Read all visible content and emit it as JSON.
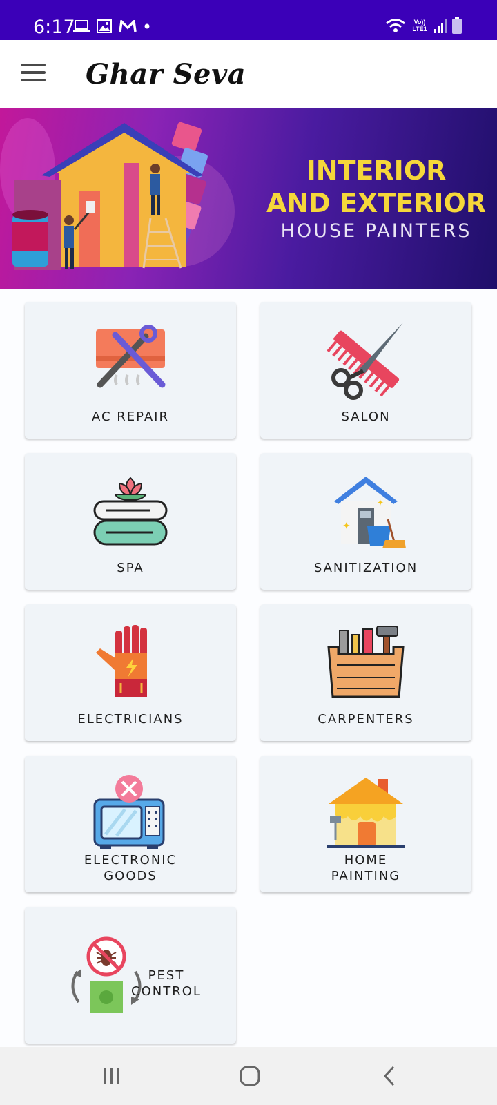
{
  "status_bar": {
    "time": "6:17",
    "network": "Vo)) LTE1"
  },
  "app_bar": {
    "title": "Ghar Seva",
    "menu_icon": "hamburger-menu-icon"
  },
  "banner": {
    "line1": "INTERIOR",
    "line2": "AND EXTERIOR",
    "line3": "HOUSE PAINTERS"
  },
  "services": [
    {
      "label": "AC REPAIR",
      "icon": "ac-repair-icon"
    },
    {
      "label": "SALON",
      "icon": "scissors-comb-icon"
    },
    {
      "label": "SPA",
      "icon": "spa-towels-icon"
    },
    {
      "label": "SANITIZATION",
      "icon": "house-cleaning-icon"
    },
    {
      "label": "ELECTRICIANS",
      "icon": "electrician-glove-icon"
    },
    {
      "label": "CARPENTERS",
      "icon": "toolbox-icon"
    },
    {
      "label": "ELECTRONIC\nGOODS",
      "icon": "microwave-repair-icon"
    },
    {
      "label": "HOME\nPAINTING",
      "icon": "house-painting-icon"
    },
    {
      "label": "PEST\nCONTROL",
      "icon": "pest-control-icon"
    }
  ],
  "nav_bar": {
    "recents": "recents-icon",
    "home": "home-icon",
    "back": "back-icon"
  }
}
